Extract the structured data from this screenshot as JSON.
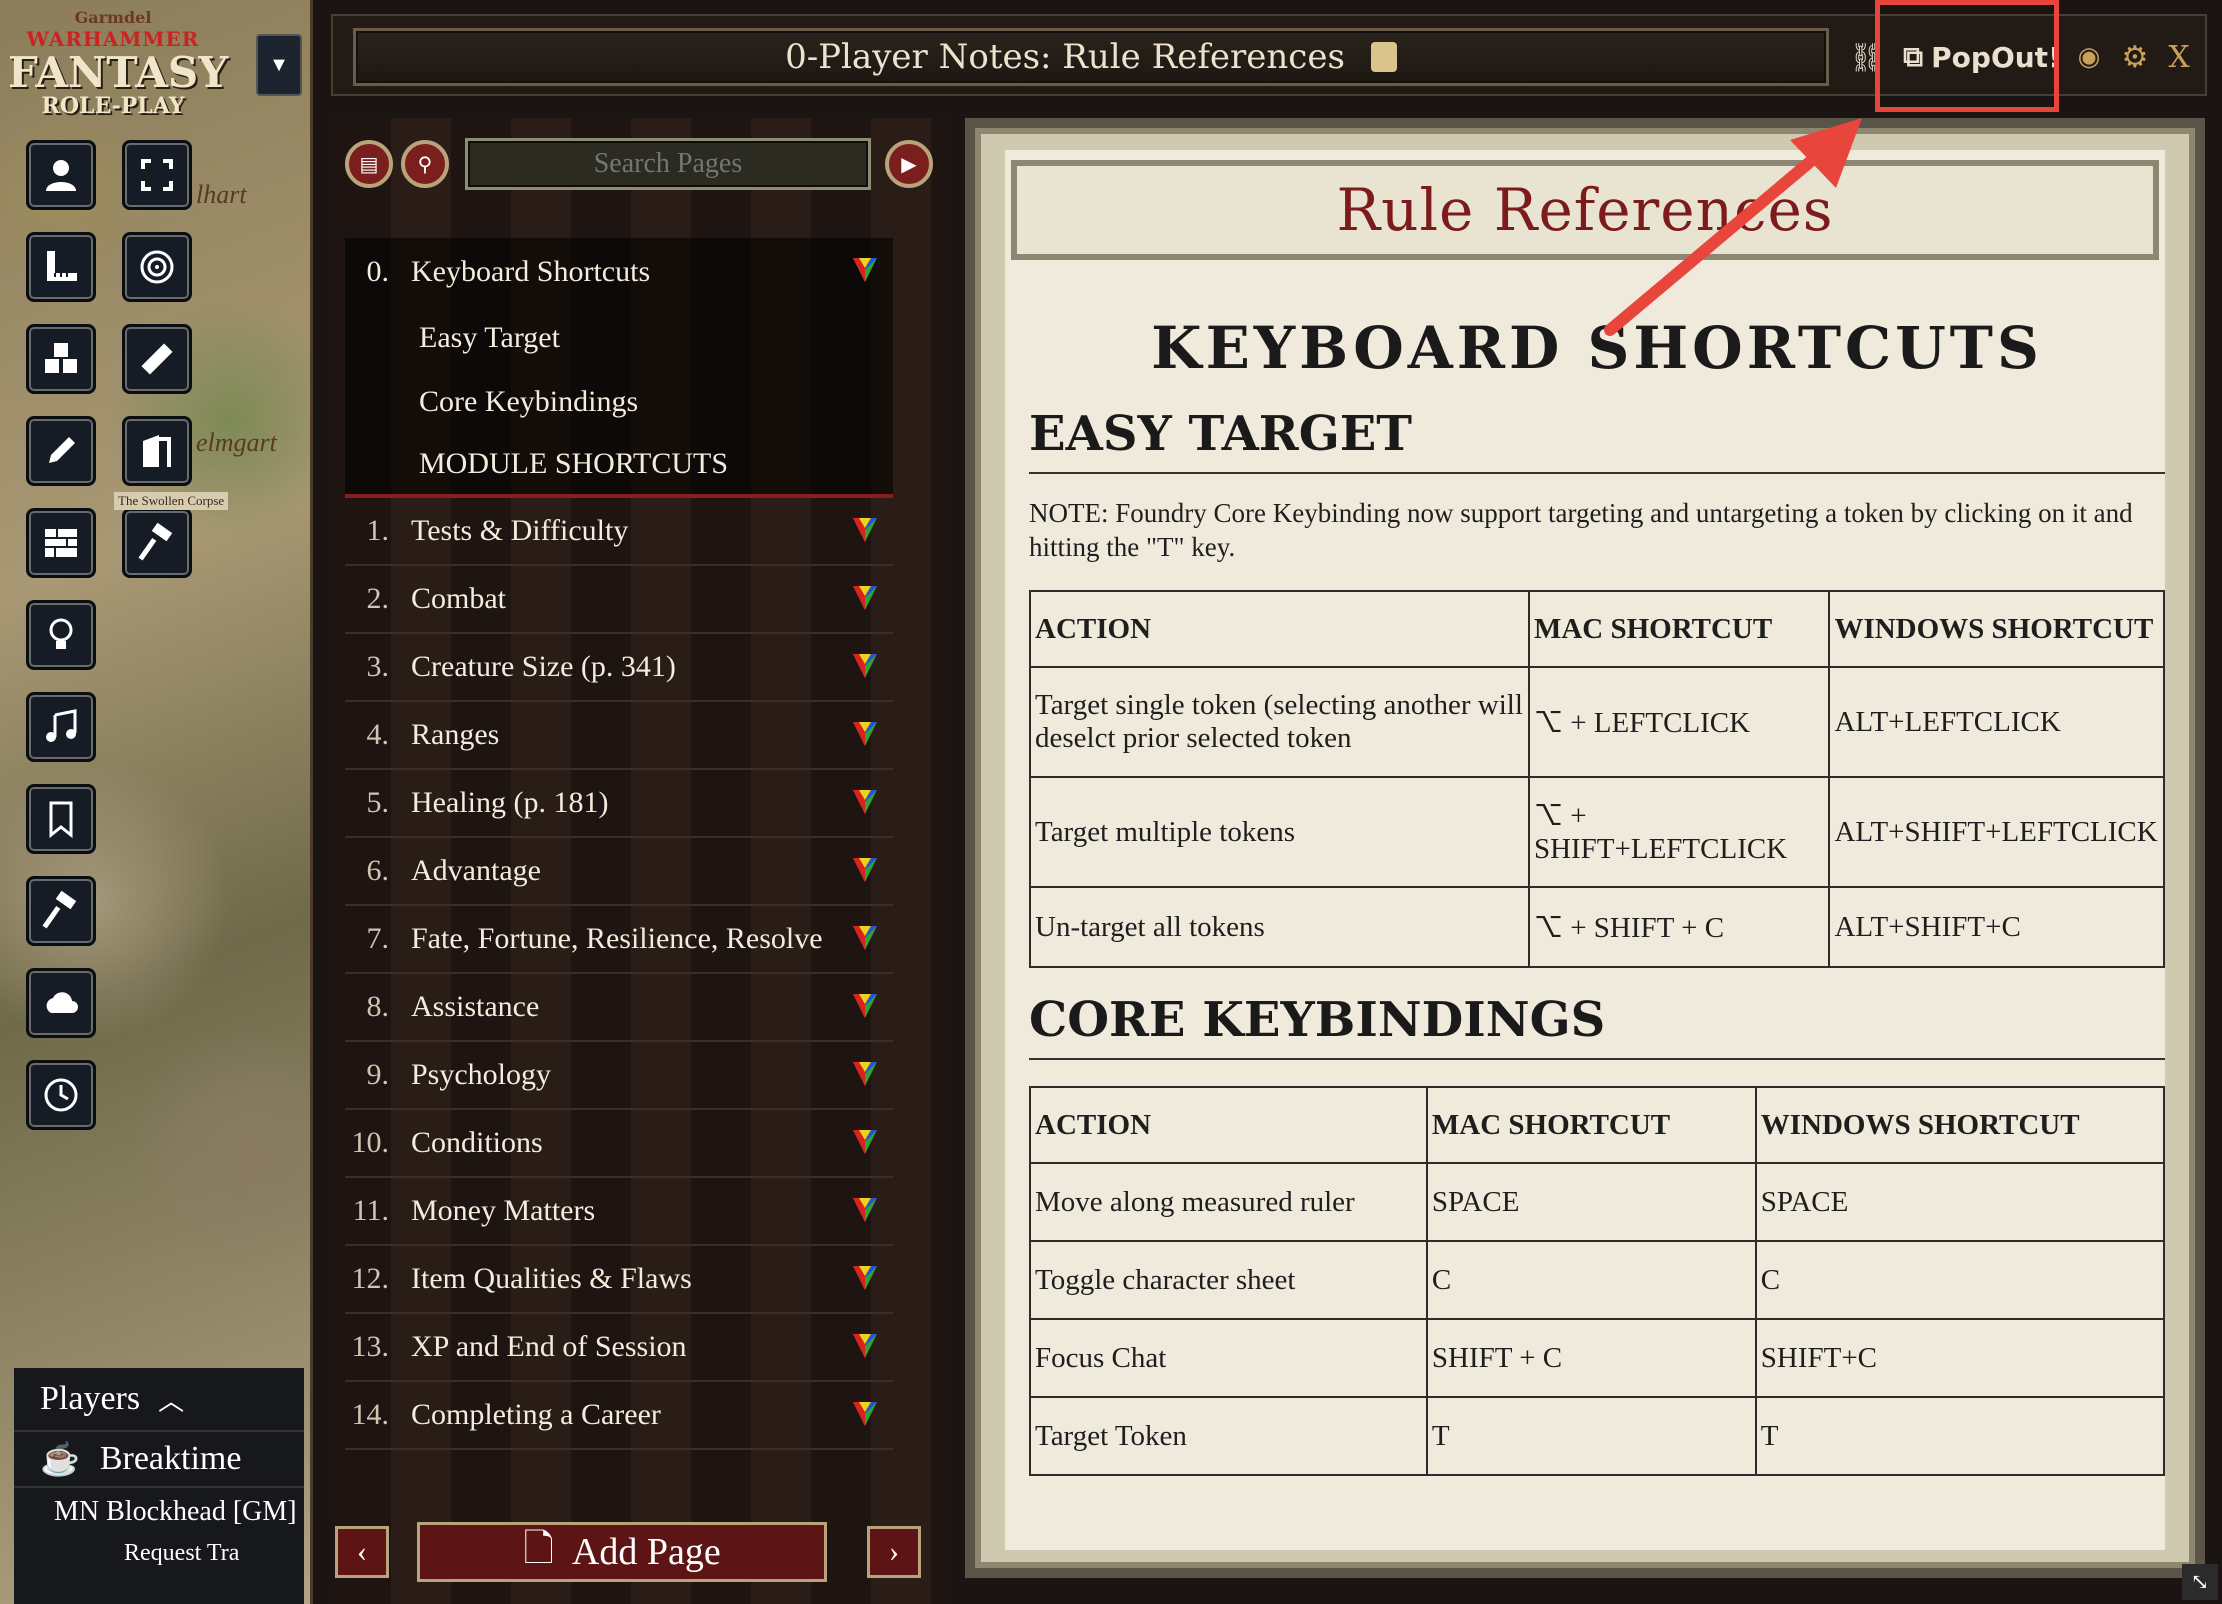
{
  "logo": {
    "line1": "Garmdel",
    "line2": "WARHAMMER",
    "line3": "FANTASY",
    "line4": "ROLE-PLAY"
  },
  "map_labels": {
    "label1": "lhart",
    "label2": "elmgart",
    "label3": "The Swollen Corpse"
  },
  "toolbar": {
    "tools": [
      "token-controls",
      "fullscreen",
      "measure",
      "target",
      "tiles",
      "ruler",
      "drawing",
      "door",
      "walls",
      "hammer",
      "lighting",
      "sounds",
      "notes",
      "hammer2",
      "weather",
      "time"
    ]
  },
  "players": {
    "header": "Players",
    "items": [
      {
        "name": "Breaktime"
      },
      {
        "name": "MN Blockhead [GM]"
      },
      {
        "name": "Request Tra"
      }
    ]
  },
  "window": {
    "title": "0-Player Notes: Rule References",
    "popout_label": "PopOut!",
    "close_label": "X"
  },
  "sidebar": {
    "search_placeholder": "Search Pages",
    "pages": [
      {
        "num": "0.",
        "label": "Keyboard Shortcuts"
      },
      {
        "num": "1.",
        "label": "Tests & Difficulty"
      },
      {
        "num": "2.",
        "label": "Combat"
      },
      {
        "num": "3.",
        "label": "Creature Size (p. 341)"
      },
      {
        "num": "4.",
        "label": "Ranges"
      },
      {
        "num": "5.",
        "label": "Healing (p. 181)"
      },
      {
        "num": "6.",
        "label": "Advantage"
      },
      {
        "num": "7.",
        "label": "Fate, Fortune, Resilience, Resolve"
      },
      {
        "num": "8.",
        "label": "Assistance"
      },
      {
        "num": "9.",
        "label": "Psychology"
      },
      {
        "num": "10.",
        "label": "Conditions"
      },
      {
        "num": "11.",
        "label": "Money Matters"
      },
      {
        "num": "12.",
        "label": "Item Qualities & Flaws"
      },
      {
        "num": "13.",
        "label": "XP and End of Session"
      },
      {
        "num": "14.",
        "label": "Completing a Career"
      }
    ],
    "subpages": [
      "Easy Target",
      "Core Keybindings",
      "MODULE SHORTCUTS"
    ],
    "add_page_label": "Add Page"
  },
  "content": {
    "banner": "Rule References",
    "heading": "KEYBOARD SHORTCUTS",
    "section1": {
      "title": "EASY TARGET",
      "note": "NOTE: Foundry Core Keybinding now support targeting and untargeting a token by clicking on it and hitting the \"T\" key.",
      "headers": [
        "ACTION",
        "MAC SHORTCUT",
        "WINDOWS SHORTCUT"
      ],
      "rows": [
        [
          "Target single token (selecting another will deselct prior selected token",
          "⌥ + LEFTCLICK",
          "ALT+LEFTCLICK"
        ],
        [
          "Target multiple tokens",
          "⌥ + SHIFT+LEFTCLICK",
          "ALT+SHIFT+LEFTCLICK"
        ],
        [
          "Un-target all tokens",
          "⌥ + SHIFT + C",
          "ALT+SHIFT+C"
        ]
      ]
    },
    "section2": {
      "title": "CORE KEYBINDINGS",
      "headers": [
        "ACTION",
        "MAC SHORTCUT",
        "WINDOWS SHORTCUT"
      ],
      "rows": [
        [
          "Move along measured ruler",
          "SPACE",
          "SPACE"
        ],
        [
          "Toggle character sheet",
          "C",
          "C"
        ],
        [
          "Focus Chat",
          "SHIFT + C",
          "SHIFT+C"
        ],
        [
          "Target Token",
          "T",
          "T"
        ]
      ]
    }
  },
  "colors": {
    "accent_red": "#7c1b1b",
    "highlight": "#e8463d",
    "parchment": "#efeadb"
  }
}
